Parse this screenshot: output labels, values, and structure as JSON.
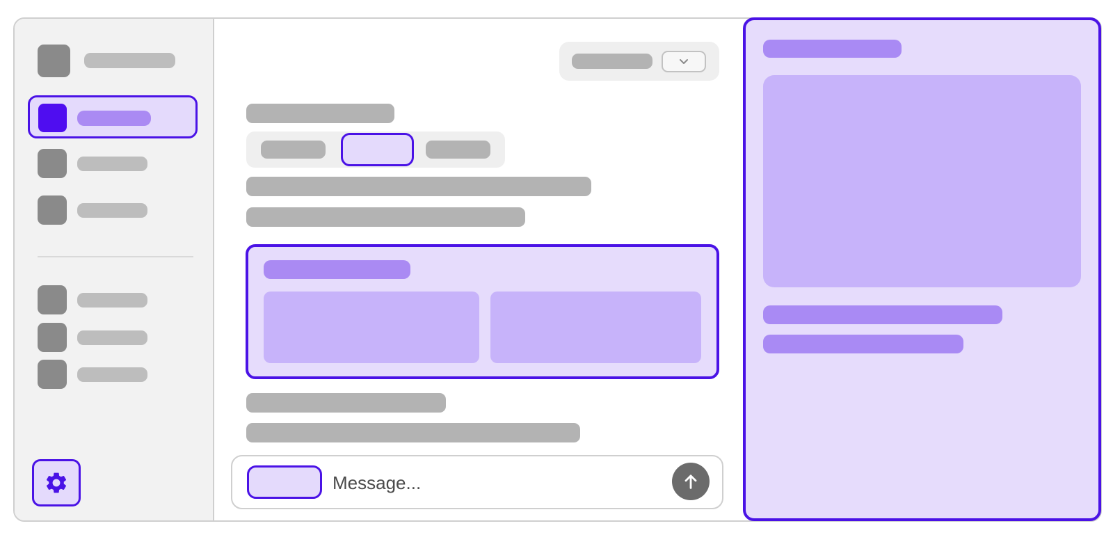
{
  "composer": {
    "placeholder": "Message..."
  },
  "colors": {
    "accent": "#4a12e6",
    "accent_fill": "#e4dafc",
    "accent_block": "#c7b3fa",
    "accent_bar": "#aa8af3",
    "skeleton": "#bdbdbd",
    "icon_gray": "#8a8a8a"
  },
  "icons": {
    "settings": "gear-icon",
    "dropdown": "chevron-down-icon",
    "send": "arrow-up-icon"
  }
}
